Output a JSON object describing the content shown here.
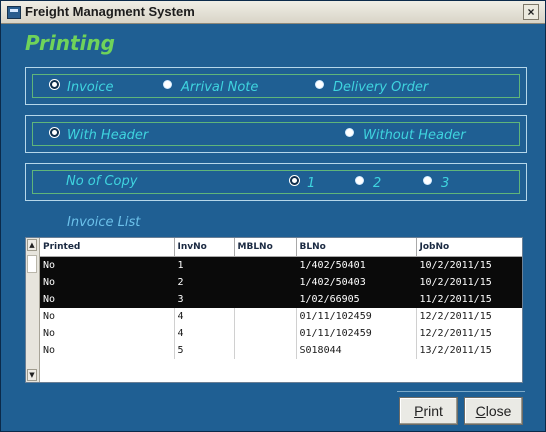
{
  "window": {
    "title": "Freight Managment System",
    "close_glyph": "×"
  },
  "heading": "Printing",
  "document_type": {
    "options": [
      {
        "label": "Invoice",
        "checked": true
      },
      {
        "label": "Arrival Note",
        "checked": false
      },
      {
        "label": "Delivery Order",
        "checked": false
      }
    ]
  },
  "header_option": {
    "options": [
      {
        "label": "With Header",
        "checked": true
      },
      {
        "label": "Without Header",
        "checked": false
      }
    ]
  },
  "copies": {
    "label": "No of Copy",
    "options": [
      {
        "label": "1",
        "checked": true
      },
      {
        "label": "2",
        "checked": false
      },
      {
        "label": "3",
        "checked": false
      }
    ]
  },
  "invoice_list": {
    "label": "Invoice List",
    "columns": [
      "Printed",
      "InvNo",
      "MBLNo",
      "BLNo",
      "JobNo"
    ],
    "rows": [
      {
        "printed": "No",
        "invno": "1",
        "mblno": "",
        "blno": "1/402/50401",
        "jobno": "10/2/2011/15",
        "selected": true
      },
      {
        "printed": "No",
        "invno": "2",
        "mblno": "",
        "blno": "1/402/50403",
        "jobno": "10/2/2011/15",
        "selected": true
      },
      {
        "printed": "No",
        "invno": "3",
        "mblno": "",
        "blno": "1/02/66905",
        "jobno": "11/2/2011/15",
        "selected": true
      },
      {
        "printed": "No",
        "invno": "4",
        "mblno": "",
        "blno": "01/11/102459",
        "jobno": "12/2/2011/15",
        "selected": false
      },
      {
        "printed": "No",
        "invno": "4",
        "mblno": "",
        "blno": "01/11/102459",
        "jobno": "12/2/2011/15",
        "selected": false
      },
      {
        "printed": "No",
        "invno": "5",
        "mblno": "",
        "blno": "S018044",
        "jobno": "13/2/2011/15",
        "selected": false
      }
    ]
  },
  "buttons": {
    "print_first": "P",
    "print_rest": "rint",
    "close_first": "C",
    "close_rest": "lose"
  },
  "icons": {
    "app": "app-window-icon",
    "close": "close-icon",
    "scroll_up": "scroll-up-arrow-icon",
    "scroll_down": "scroll-down-arrow-icon"
  },
  "colors": {
    "window_bg": "#1f5f93",
    "heading": "#6fd35a",
    "option_text": "#3fd4df",
    "selected_row": "#0a0a0a"
  }
}
